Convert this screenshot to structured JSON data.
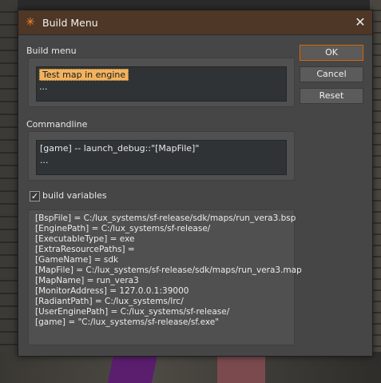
{
  "window": {
    "title": "Build Menu",
    "app_icon": "asterisk-icon",
    "close_icon": "close-icon"
  },
  "build_menu": {
    "label": "Build menu",
    "items": [
      "Test map in engine",
      "..."
    ]
  },
  "commandline": {
    "label": "Commandline",
    "lines": [
      "[game] -- launch_debug::\"[MapFile]\"",
      "..."
    ]
  },
  "buttons": {
    "ok": "OK",
    "cancel": "Cancel",
    "reset": "Reset"
  },
  "build_variables": {
    "label": "build variables",
    "checked": true,
    "check_glyph": "✓",
    "lines": [
      "[BspFile] = C:/lux_systems/sf-release/sdk/maps/run_vera3.bsp",
      "[EnginePath] = C:/lux_systems/sf-release/",
      "[ExecutableType] = exe",
      "[ExtraResourcePaths] =",
      "[GameName] = sdk",
      "[MapFile] = C:/lux_systems/sf-release/sdk/maps/run_vera3.map",
      "[MapName] = run_vera3",
      "[MonitorAddress] = 127.0.0.1:39000",
      "[RadiantPath] = C:/lux_systems/lrc/",
      "[UserEnginePath] = C:/lux_systems/sf-release/",
      "[game] = \"C:/lux_systems/sf-release/sf.exe\""
    ]
  },
  "colors": {
    "titlebar": "#4e3726",
    "accent": "#f2b35f",
    "dialog": "#464646"
  }
}
